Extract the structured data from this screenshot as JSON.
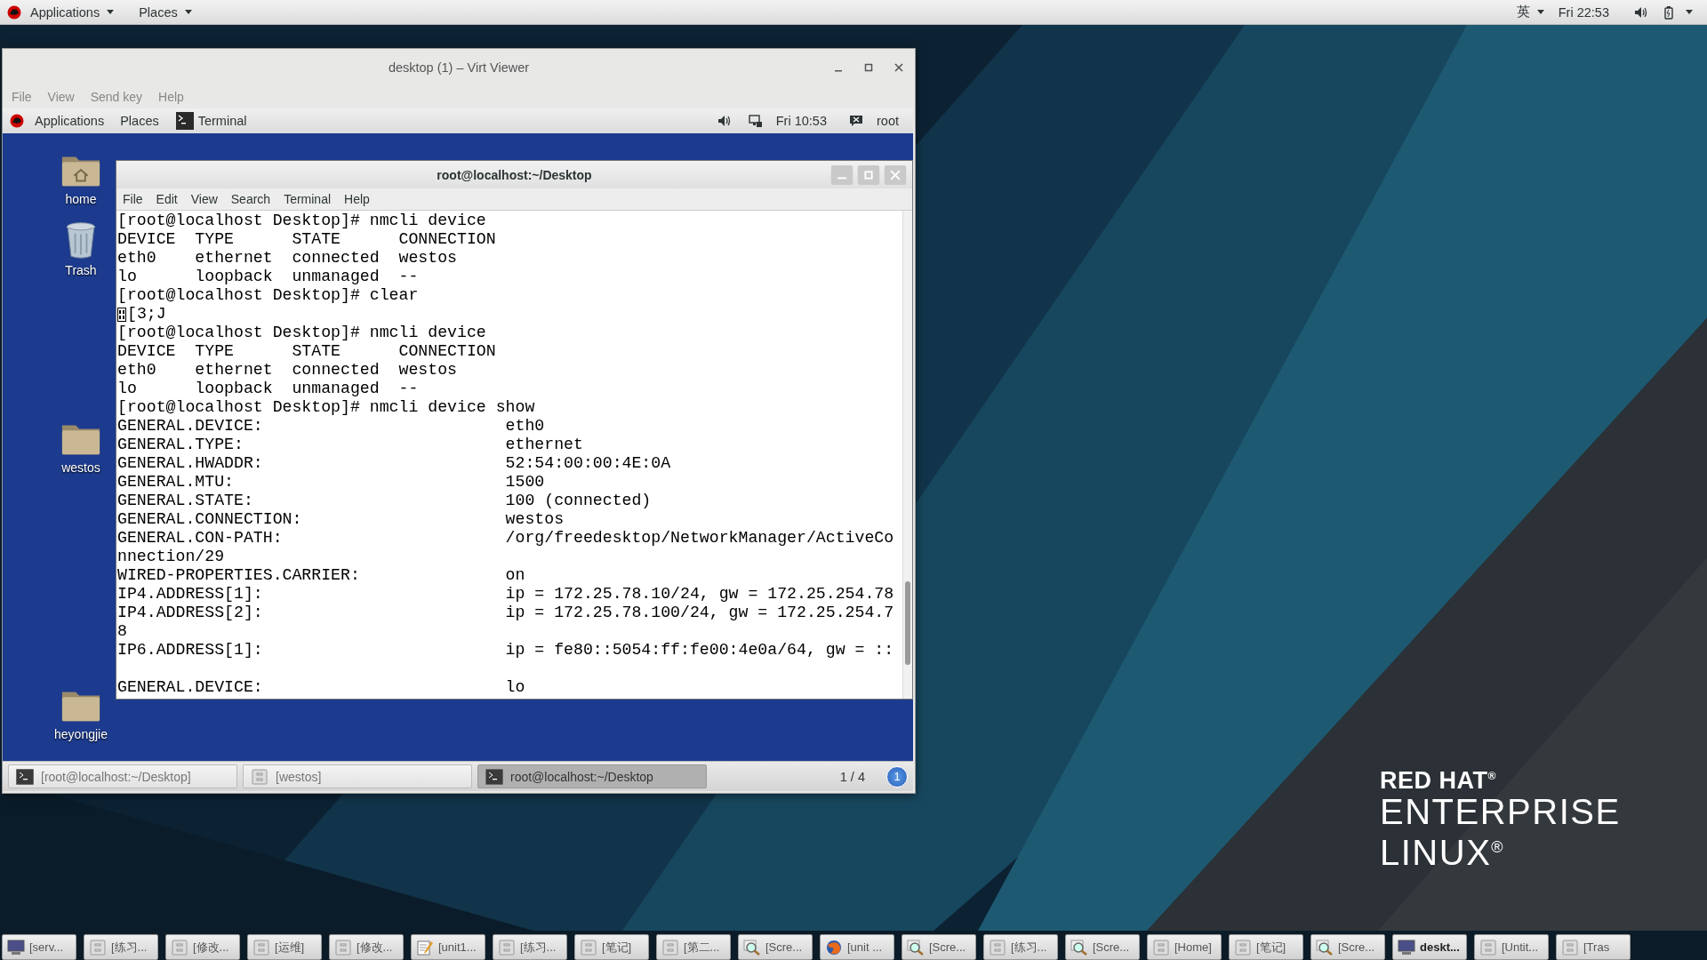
{
  "top_bar": {
    "menus": [
      {
        "label": "Applications"
      },
      {
        "label": "Places"
      }
    ],
    "input_method": "英",
    "clock": "Fri 22:53"
  },
  "vm_window": {
    "title": "desktop (1) – Virt Viewer",
    "menu": [
      "File",
      "View",
      "Send key",
      "Help"
    ],
    "guest": {
      "top_bar": {
        "menus": [
          "Applications",
          "Places"
        ],
        "active_app": "Terminal",
        "clock": "Fri 10:53",
        "user": "root"
      },
      "desktop_icons": [
        {
          "label": "home",
          "kind": "home"
        },
        {
          "label": "Trash",
          "kind": "trash"
        },
        {
          "label": "westos",
          "kind": "folder"
        },
        {
          "label": "heyongjie",
          "kind": "folder"
        }
      ],
      "terminal": {
        "title": "root@localhost:~/Desktop",
        "menu": [
          "File",
          "Edit",
          "View",
          "Search",
          "Terminal",
          "Help"
        ],
        "lines": [
          {
            "kind": "text",
            "text": "[root@localhost Desktop]# nmcli device"
          },
          {
            "kind": "text",
            "text": "DEVICE  TYPE      STATE      CONNECTION"
          },
          {
            "kind": "text",
            "text": "eth0    ethernet  connected  westos"
          },
          {
            "kind": "text",
            "text": "lo      loopback  unmanaged  --"
          },
          {
            "kind": "text",
            "text": "[root@localhost Desktop]# clear"
          },
          {
            "kind": "escape",
            "text": "[3;J"
          },
          {
            "kind": "text",
            "text": "[root@localhost Desktop]# nmcli device"
          },
          {
            "kind": "text",
            "text": "DEVICE  TYPE      STATE      CONNECTION"
          },
          {
            "kind": "text",
            "text": "eth0    ethernet  connected  westos"
          },
          {
            "kind": "text",
            "text": "lo      loopback  unmanaged  --"
          },
          {
            "kind": "text",
            "text": "[root@localhost Desktop]# nmcli device show"
          },
          {
            "kind": "text",
            "text": "GENERAL.DEVICE:                         eth0"
          },
          {
            "kind": "text",
            "text": "GENERAL.TYPE:                           ethernet"
          },
          {
            "kind": "text",
            "text": "GENERAL.HWADDR:                         52:54:00:00:4E:0A"
          },
          {
            "kind": "text",
            "text": "GENERAL.MTU:                            1500"
          },
          {
            "kind": "text",
            "text": "GENERAL.STATE:                          100 (connected)"
          },
          {
            "kind": "text",
            "text": "GENERAL.CONNECTION:                     westos"
          },
          {
            "kind": "text",
            "text": "GENERAL.CON-PATH:                       /org/freedesktop/NetworkManager/ActiveCo"
          },
          {
            "kind": "text",
            "text": "nnection/29"
          },
          {
            "kind": "text",
            "text": "WIRED-PROPERTIES.CARRIER:               on"
          },
          {
            "kind": "text",
            "text": "IP4.ADDRESS[1]:                         ip = 172.25.78.10/24, gw = 172.25.254.78"
          },
          {
            "kind": "text",
            "text": "IP4.ADDRESS[2]:                         ip = 172.25.78.100/24, gw = 172.25.254.7"
          },
          {
            "kind": "text",
            "text": "8"
          },
          {
            "kind": "text",
            "text": "IP6.ADDRESS[1]:                         ip = fe80::5054:ff:fe00:4e0a/64, gw = ::"
          },
          {
            "kind": "blank"
          },
          {
            "kind": "text",
            "text": "GENERAL.DEVICE:                         lo"
          }
        ]
      },
      "window_list": [
        {
          "label": "[root@localhost:~/Desktop]",
          "kind": "terminal",
          "selected": false
        },
        {
          "label": "[westos]",
          "kind": "folder",
          "selected": false
        },
        {
          "label": "root@localhost:~/Desktop",
          "kind": "terminal",
          "selected": true
        }
      ],
      "workspace": "1 / 4",
      "notification_count": "1"
    }
  },
  "wallpaper_logo": {
    "line_1": "RED HAT$^{®}$",
    "line_2": "ENTERPRISE",
    "line_3": "LINUX$^{®}$"
  },
  "taskbar": [
    {
      "label": "[serv...",
      "kind": "monitor",
      "selected": false
    },
    {
      "label": "[练习...",
      "kind": "folder",
      "selected": false
    },
    {
      "label": "[修改...",
      "kind": "folder",
      "selected": false
    },
    {
      "label": "[运维]",
      "kind": "folder",
      "selected": false
    },
    {
      "label": "[修改...",
      "kind": "folder",
      "selected": false
    },
    {
      "label": "[unit1...",
      "kind": "editor",
      "selected": false
    },
    {
      "label": "[练习...",
      "kind": "folder",
      "selected": false
    },
    {
      "label": "[笔记]",
      "kind": "folder",
      "selected": false
    },
    {
      "label": "[第二...",
      "kind": "folder",
      "selected": false
    },
    {
      "label": "[Scre...",
      "kind": "screenshot",
      "selected": false
    },
    {
      "label": "[unit ...",
      "kind": "browser",
      "selected": false
    },
    {
      "label": "[Scre...",
      "kind": "screenshot",
      "selected": false
    },
    {
      "label": "[练习...",
      "kind": "folder",
      "selected": false
    },
    {
      "label": "[Scre...",
      "kind": "screenshot",
      "selected": false
    },
    {
      "label": "[Home]",
      "kind": "folder",
      "selected": false
    },
    {
      "label": "[笔记]",
      "kind": "folder",
      "selected": false
    },
    {
      "label": "[Scre...",
      "kind": "screenshot",
      "selected": false
    },
    {
      "label": "deskt...",
      "kind": "monitor",
      "selected": true
    },
    {
      "label": "[Untit...",
      "kind": "folder",
      "selected": false
    },
    {
      "label": "[Tras",
      "kind": "folder",
      "selected": false
    }
  ]
}
